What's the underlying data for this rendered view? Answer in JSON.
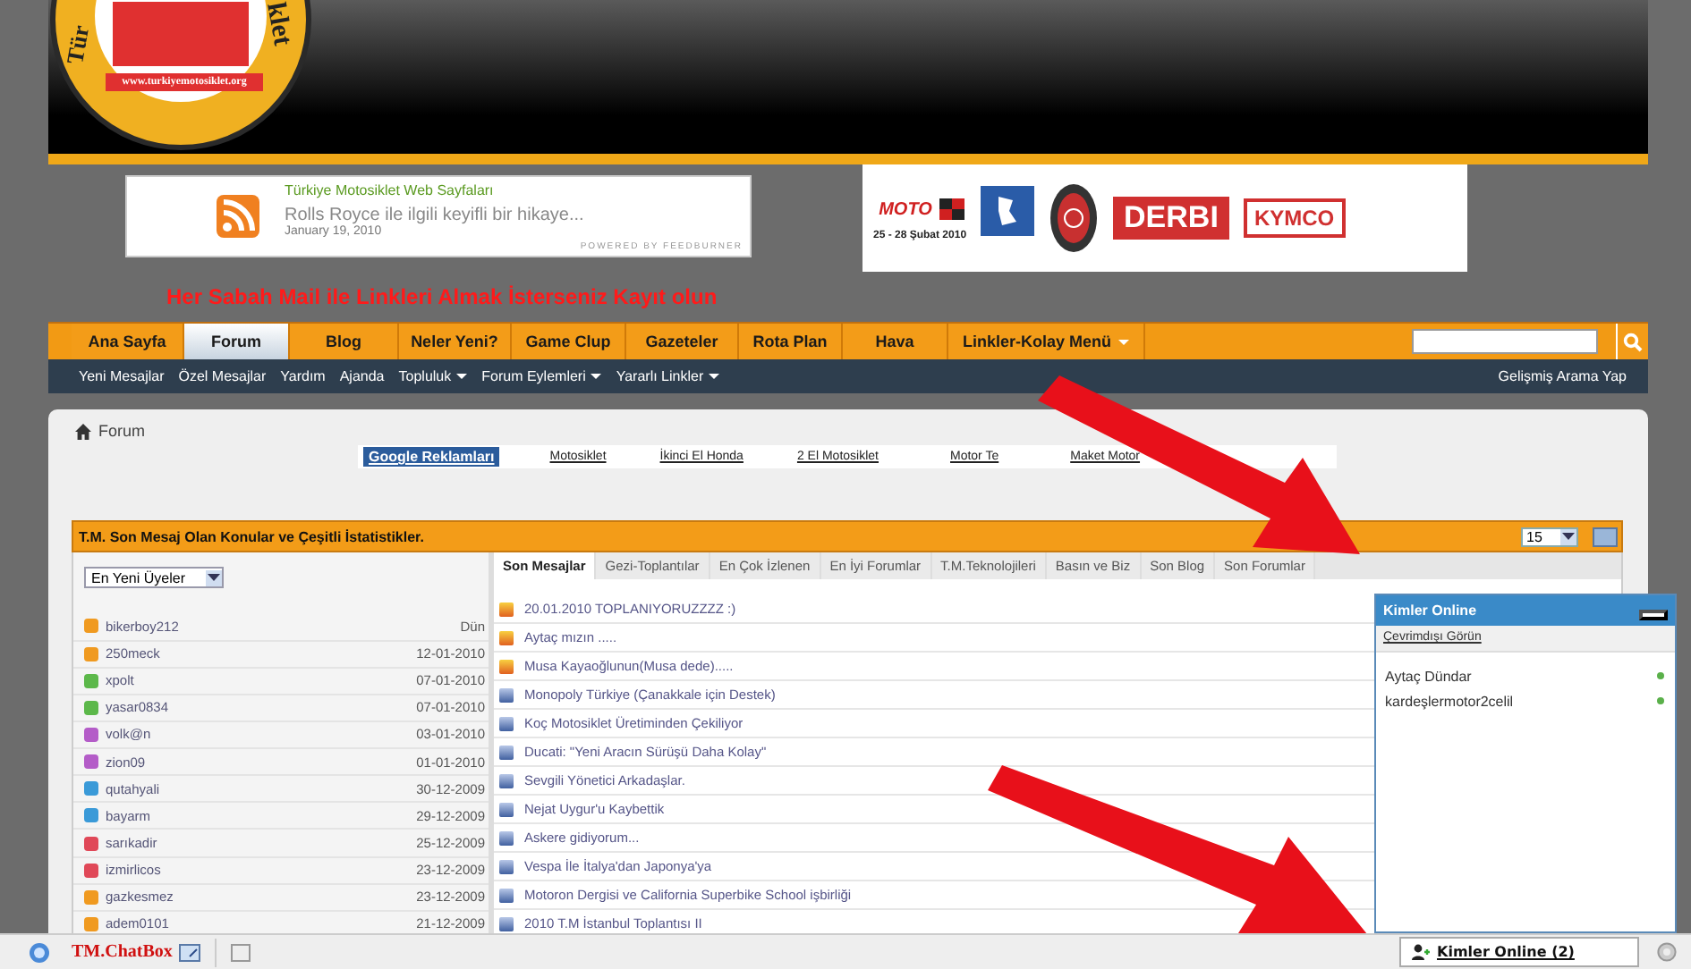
{
  "header": {
    "logo": {
      "arc_left": "Tür",
      "arc_right": "klet",
      "url": "www.turkiyemotosiklet.org"
    }
  },
  "feed": {
    "title": "Türkiye Motosiklet Web Sayfaları",
    "headline": "Rolls Royce ile ilgili keyifli bir hikaye...",
    "date": "January 19, 2010",
    "credit": "POWERED BY FEEDBURNER"
  },
  "sponsors": {
    "expo_logo": "MOTO",
    "expo_dates": "25 - 28 Şubat 2010",
    "brand_1": "DERBI",
    "brand_2": "KYMCO"
  },
  "signup_notice": "Her Sabah Mail ile Linkleri Almak İsterseniz Kayıt olun",
  "nav": {
    "items": [
      {
        "label": "Ana Sayfa",
        "selected": false,
        "dropdown": false
      },
      {
        "label": "Forum",
        "selected": true,
        "dropdown": false
      },
      {
        "label": "Blog",
        "selected": false,
        "dropdown": false
      },
      {
        "label": "Neler Yeni?",
        "selected": false,
        "dropdown": false
      },
      {
        "label": "Game Clup",
        "selected": false,
        "dropdown": false
      },
      {
        "label": "Gazeteler",
        "selected": false,
        "dropdown": false
      },
      {
        "label": "Rota Plan",
        "selected": false,
        "dropdown": false
      },
      {
        "label": "Hava",
        "selected": false,
        "dropdown": false
      },
      {
        "label": "Linkler-Kolay Menü",
        "selected": false,
        "dropdown": true
      }
    ]
  },
  "subnav": {
    "items": [
      {
        "label": "Yeni Mesajlar",
        "dropdown": false
      },
      {
        "label": "Özel Mesajlar",
        "dropdown": false
      },
      {
        "label": "Yardım",
        "dropdown": false
      },
      {
        "label": "Ajanda",
        "dropdown": false
      },
      {
        "label": "Topluluk",
        "dropdown": true
      },
      {
        "label": "Forum Eylemleri",
        "dropdown": true
      },
      {
        "label": "Yararlı Linkler",
        "dropdown": true
      }
    ],
    "advanced_search": "Gelişmiş Arama Yap"
  },
  "breadcrumb": "Forum",
  "ad_links": [
    {
      "label": "Google Reklamları",
      "kind": "header"
    },
    {
      "label": "Motosiklet",
      "kind": "link"
    },
    {
      "label": "İkinci El Honda",
      "kind": "link"
    },
    {
      "label": "2 El Motosiklet",
      "kind": "link"
    },
    {
      "label": "Motor Te",
      "kind": "link"
    },
    {
      "label": "Maket Motor",
      "kind": "link"
    }
  ],
  "stats": {
    "title": "T.M. Son Mesaj Olan Konular ve Çeşitli İstatistikler.",
    "count_select": "15",
    "members_select": "En Yeni Üyeler",
    "members": [
      {
        "name": "bikerboy212",
        "date": "Dün",
        "color": "#f09a20"
      },
      {
        "name": "250meck",
        "date": "12-01-2010",
        "color": "#f09a20"
      },
      {
        "name": "xpolt",
        "date": "07-01-2010",
        "color": "#5cb84a"
      },
      {
        "name": "yasar0834",
        "date": "07-01-2010",
        "color": "#5cb84a"
      },
      {
        "name": "volk@n",
        "date": "03-01-2010",
        "color": "#b45cc8"
      },
      {
        "name": "zion09",
        "date": "01-01-2010",
        "color": "#b45cc8"
      },
      {
        "name": "qutahyali",
        "date": "30-12-2009",
        "color": "#3a9ad8"
      },
      {
        "name": "bayarm",
        "date": "29-12-2009",
        "color": "#3a9ad8"
      },
      {
        "name": "sarıkadir",
        "date": "25-12-2009",
        "color": "#e04858"
      },
      {
        "name": "izmirlicos",
        "date": "23-12-2009",
        "color": "#e04858"
      },
      {
        "name": "gazkesmez",
        "date": "23-12-2009",
        "color": "#f09a20"
      },
      {
        "name": "adem0101",
        "date": "21-12-2009",
        "color": "#f09a20"
      }
    ],
    "tabs": [
      {
        "label": "Son Mesajlar",
        "selected": true
      },
      {
        "label": "Gezi-Toplantılar",
        "selected": false
      },
      {
        "label": "En Çok İzlenen",
        "selected": false
      },
      {
        "label": "En İyi Forumlar",
        "selected": false
      },
      {
        "label": "T.M.Teknolojileri",
        "selected": false
      },
      {
        "label": "Basın ve Biz",
        "selected": false
      },
      {
        "label": "Son Blog",
        "selected": false
      },
      {
        "label": "Son Forumlar",
        "selected": false
      }
    ],
    "threads": [
      {
        "title": "20.01.2010 TOPLANIYORUZZZZ :)",
        "hot": true
      },
      {
        "title": "Aytaç mızın .....",
        "hot": true
      },
      {
        "title": "Musa Kayaoğlunun(Musa dede).....",
        "hot": true
      },
      {
        "title": "Monopoly Türkiye (Çanakkale için Destek)",
        "hot": false
      },
      {
        "title": "Koç Motosiklet Üretiminden Çekiliyor",
        "hot": false
      },
      {
        "title": "Ducati: \"Yeni Aracın Sürüşü Daha Kolay\"",
        "hot": false
      },
      {
        "title": "Sevgili Yönetici Arkadaşlar.",
        "hot": false
      },
      {
        "title": "Nejat Uygur'u Kaybettik",
        "hot": false
      },
      {
        "title": "Askere gidiyorum...",
        "hot": false
      },
      {
        "title": "Vespa İle İtalya'dan Japonya'ya",
        "hot": false
      },
      {
        "title": "Motoron Dergisi ve California Superbike School işbirliği",
        "hot": false
      },
      {
        "title": "2010 T.M İstanbul Toplantısı II",
        "hot": false
      }
    ]
  },
  "online_panel": {
    "title": "Kimler Online",
    "invisible_link": "Çevrimdışı Görün",
    "users": [
      {
        "name": "Aytaç Dündar",
        "online": true
      },
      {
        "name": "kardeşlermotor2celil",
        "online": true
      }
    ]
  },
  "chat_bar": {
    "chatbox": "TM.ChatBox",
    "online_tab": "Kimler Online (2)"
  }
}
